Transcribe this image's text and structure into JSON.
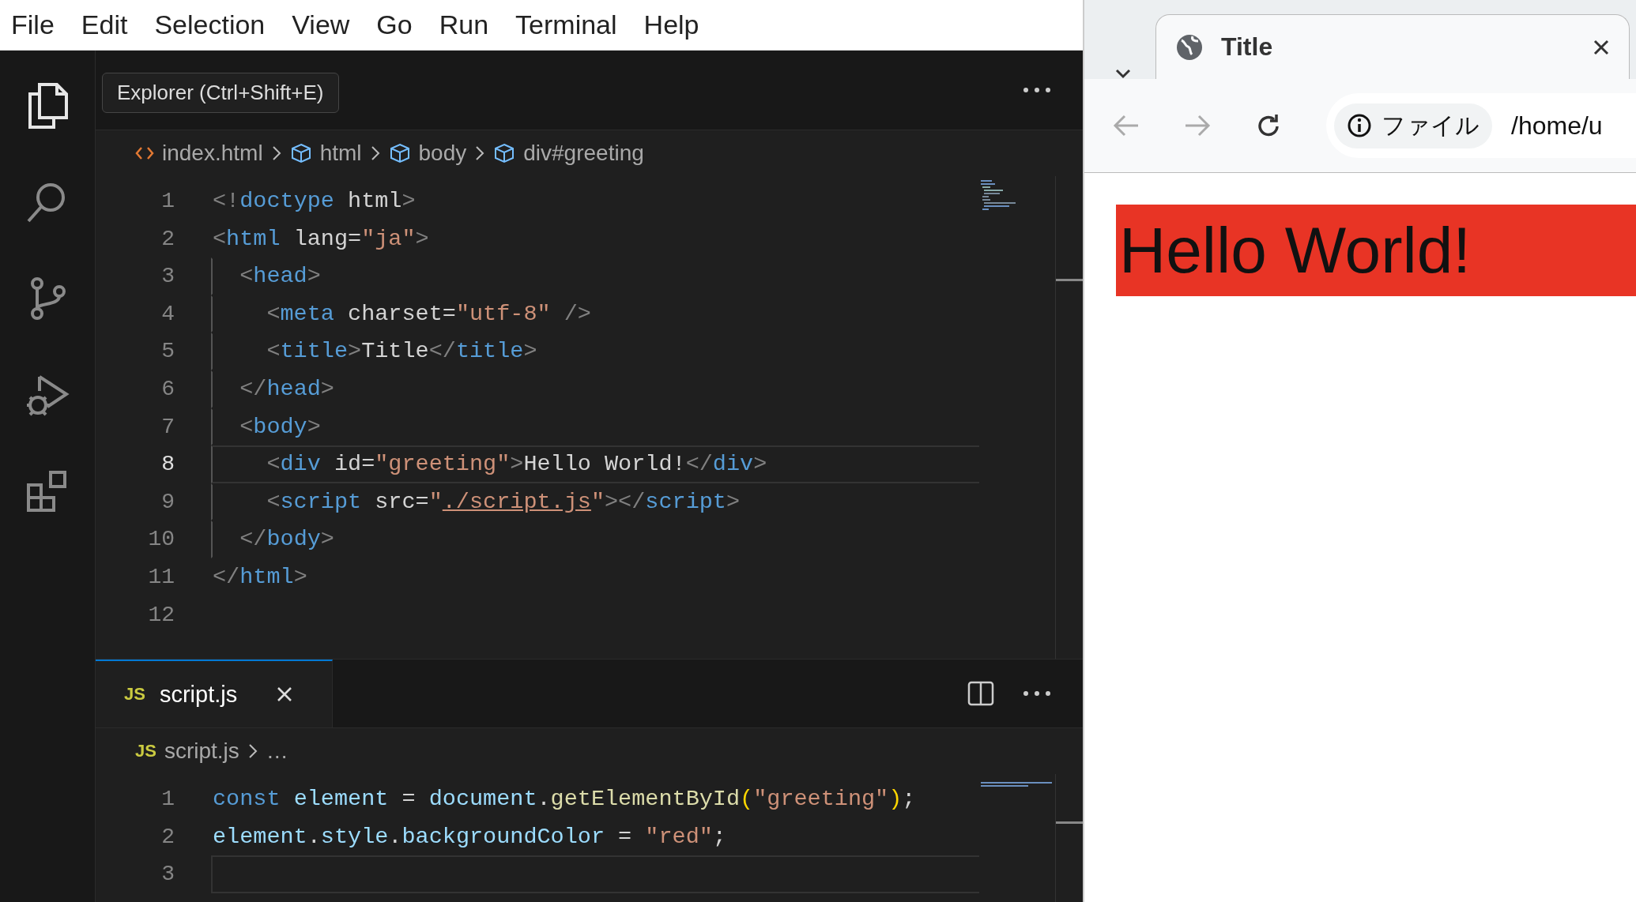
{
  "menu": [
    "File",
    "Edit",
    "Selection",
    "View",
    "Go",
    "Run",
    "Terminal",
    "Help"
  ],
  "activity_bar": [
    {
      "kind": "files",
      "selected": true
    },
    {
      "kind": "search",
      "selected": false
    },
    {
      "kind": "branch",
      "selected": false
    },
    {
      "kind": "run",
      "selected": false
    },
    {
      "kind": "extensions",
      "selected": false
    }
  ],
  "tooltip": "Explorer (Ctrl+Shift+E)",
  "editor": {
    "focused": true,
    "breadcrumb": [
      {
        "kind": "html",
        "label": "index.html"
      },
      {
        "kind": "element",
        "label": "html"
      },
      {
        "kind": "element",
        "label": "body"
      },
      {
        "kind": "element",
        "label": "div#greeting"
      }
    ],
    "lines": [
      {
        "number": "1",
        "current": false,
        "tokens": [
          {
            "text": "<!",
            "kind": "p"
          },
          {
            "text": "doctype",
            "kind": "tag"
          },
          {
            "text": " html",
            "kind": "attr"
          },
          {
            "text": ">",
            "kind": "p"
          }
        ]
      },
      {
        "number": "2",
        "current": false,
        "tokens": [
          {
            "text": "<",
            "kind": "p"
          },
          {
            "text": "html",
            "kind": "tag"
          },
          {
            "text": " lang=",
            "kind": "attr"
          },
          {
            "text": "\"ja\"",
            "kind": "str"
          },
          {
            "text": ">",
            "kind": "p"
          }
        ]
      },
      {
        "number": "3",
        "current": false,
        "tokens": [
          {
            "text": "  <",
            "kind": "p"
          },
          {
            "text": "head",
            "kind": "tag"
          },
          {
            "text": ">",
            "kind": "p"
          }
        ]
      },
      {
        "number": "4",
        "current": false,
        "tokens": [
          {
            "text": "    <",
            "kind": "p"
          },
          {
            "text": "meta",
            "kind": "tag"
          },
          {
            "text": " charset=",
            "kind": "attr"
          },
          {
            "text": "\"utf-8\"",
            "kind": "str"
          },
          {
            "text": " />",
            "kind": "p"
          }
        ]
      },
      {
        "number": "5",
        "current": false,
        "tokens": [
          {
            "text": "    <",
            "kind": "p"
          },
          {
            "text": "title",
            "kind": "tag"
          },
          {
            "text": ">",
            "kind": "p"
          },
          {
            "text": "Title",
            "kind": "text"
          },
          {
            "text": "</",
            "kind": "p"
          },
          {
            "text": "title",
            "kind": "tag"
          },
          {
            "text": ">",
            "kind": "p"
          }
        ]
      },
      {
        "number": "6",
        "current": false,
        "tokens": [
          {
            "text": "  </",
            "kind": "p"
          },
          {
            "text": "head",
            "kind": "tag"
          },
          {
            "text": ">",
            "kind": "p"
          }
        ]
      },
      {
        "number": "7",
        "current": false,
        "tokens": [
          {
            "text": "  <",
            "kind": "p"
          },
          {
            "text": "body",
            "kind": "tag"
          },
          {
            "text": ">",
            "kind": "p"
          }
        ]
      },
      {
        "number": "8",
        "current": true,
        "tokens": [
          {
            "text": "    <",
            "kind": "p"
          },
          {
            "text": "div",
            "kind": "tag"
          },
          {
            "text": " id=",
            "kind": "attr"
          },
          {
            "text": "\"greeting\"",
            "kind": "str"
          },
          {
            "text": ">",
            "kind": "p"
          },
          {
            "text": "Hello World!",
            "kind": "text"
          },
          {
            "text": "</",
            "kind": "p"
          },
          {
            "text": "div",
            "kind": "tag"
          },
          {
            "text": ">",
            "kind": "p"
          }
        ]
      },
      {
        "number": "9",
        "current": false,
        "tokens": [
          {
            "text": "    <",
            "kind": "p"
          },
          {
            "text": "script",
            "kind": "tag"
          },
          {
            "text": " src=",
            "kind": "attr"
          },
          {
            "text": "\"",
            "kind": "str"
          },
          {
            "text": "./script.js",
            "kind": "link"
          },
          {
            "text": "\"",
            "kind": "str"
          },
          {
            "text": "></",
            "kind": "p"
          },
          {
            "text": "script",
            "kind": "tag"
          },
          {
            "text": ">",
            "kind": "p"
          }
        ]
      },
      {
        "number": "10",
        "current": false,
        "tokens": [
          {
            "text": "  </",
            "kind": "p"
          },
          {
            "text": "body",
            "kind": "tag"
          },
          {
            "text": ">",
            "kind": "p"
          }
        ]
      },
      {
        "number": "11",
        "current": false,
        "tokens": [
          {
            "text": "</",
            "kind": "p"
          },
          {
            "text": "html",
            "kind": "tag"
          },
          {
            "text": ">",
            "kind": "p"
          }
        ]
      },
      {
        "number": "12",
        "current": false
      }
    ]
  },
  "panel": {
    "focused": false,
    "tab": {
      "badge": "JS",
      "label": "script.js",
      "selected": true
    },
    "breadcrumb": [
      {
        "badge": "JS",
        "label": "script.js"
      },
      {
        "label": "…"
      }
    ],
    "lines": [
      {
        "number": "1",
        "current": false,
        "tokens": [
          {
            "text": "const ",
            "kind": "kw"
          },
          {
            "text": "element",
            "kind": "var"
          },
          {
            "text": " = ",
            "kind": "text"
          },
          {
            "text": "document",
            "kind": "var"
          },
          {
            "text": ".",
            "kind": "text"
          },
          {
            "text": "getElementById",
            "kind": "fn"
          },
          {
            "text": "(",
            "kind": "paren"
          },
          {
            "text": "\"greeting\"",
            "kind": "str"
          },
          {
            "text": ")",
            "kind": "paren"
          },
          {
            "text": ";",
            "kind": "text"
          }
        ]
      },
      {
        "number": "2",
        "current": false,
        "tokens": [
          {
            "text": "element",
            "kind": "var"
          },
          {
            "text": ".",
            "kind": "text"
          },
          {
            "text": "style",
            "kind": "var"
          },
          {
            "text": ".",
            "kind": "text"
          },
          {
            "text": "backgroundColor",
            "kind": "var"
          },
          {
            "text": " = ",
            "kind": "text"
          },
          {
            "text": "\"red\"",
            "kind": "str"
          },
          {
            "text": ";",
            "kind": "text"
          }
        ]
      },
      {
        "number": "3",
        "current": true
      }
    ]
  },
  "browser": {
    "tab": {
      "title": "Title",
      "selected": true
    },
    "omnibox": {
      "chip": "ファイル",
      "url": "/home/u"
    },
    "page": {
      "heading": "Hello World!"
    }
  }
}
